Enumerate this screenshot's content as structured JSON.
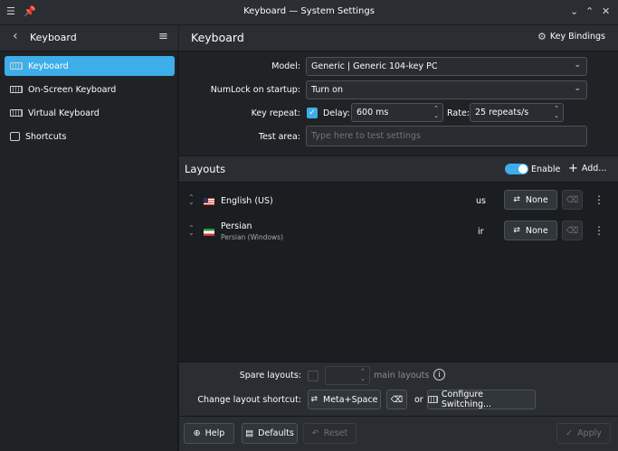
{
  "window": {
    "title": "Keyboard — System Settings"
  },
  "sidebar": {
    "back_label": "Keyboard",
    "items": [
      {
        "label": "Keyboard",
        "icon": "keyboard-icon",
        "active": true
      },
      {
        "label": "On-Screen Keyboard",
        "icon": "keyboard-icon",
        "active": false
      },
      {
        "label": "Virtual Keyboard",
        "icon": "keyboard-icon",
        "active": false
      },
      {
        "label": "Shortcuts",
        "icon": "shortcuts-icon",
        "active": false
      }
    ]
  },
  "header": {
    "title": "Keyboard",
    "key_bindings_label": "Key Bindings"
  },
  "form": {
    "model_label": "Model:",
    "model_value": "Generic | Generic 104-key PC",
    "numlock_label": "NumLock on startup:",
    "numlock_value": "Turn on",
    "key_repeat_label": "Key repeat:",
    "key_repeat_checked": true,
    "delay_label": "Delay:",
    "delay_value": "600 ms",
    "rate_label": "Rate:",
    "rate_value": "25 repeats/s",
    "test_area_label": "Test area:",
    "test_area_placeholder": "Type here to test settings"
  },
  "layouts": {
    "title": "Layouts",
    "enable_label": "Enable",
    "enabled": true,
    "add_label": "Add...",
    "items": [
      {
        "name": "English (US)",
        "variant": "",
        "code": "us",
        "shortcut": "None"
      },
      {
        "name": "Persian",
        "variant": "Persian (Windows)",
        "code": "ir",
        "shortcut": "None"
      }
    ]
  },
  "bottom": {
    "spare_label": "Spare layouts:",
    "main_layouts_label": "main layouts",
    "change_shortcut_label": "Change layout shortcut:",
    "shortcut_value": "Meta+Space",
    "or_label": "or",
    "configure_label": "Configure Switching..."
  },
  "footer": {
    "help": "Help",
    "defaults": "Defaults",
    "reset": "Reset",
    "apply": "Apply"
  },
  "colors": {
    "accent": "#3daee9",
    "background": "#202326",
    "panel": "#2a2e32"
  }
}
